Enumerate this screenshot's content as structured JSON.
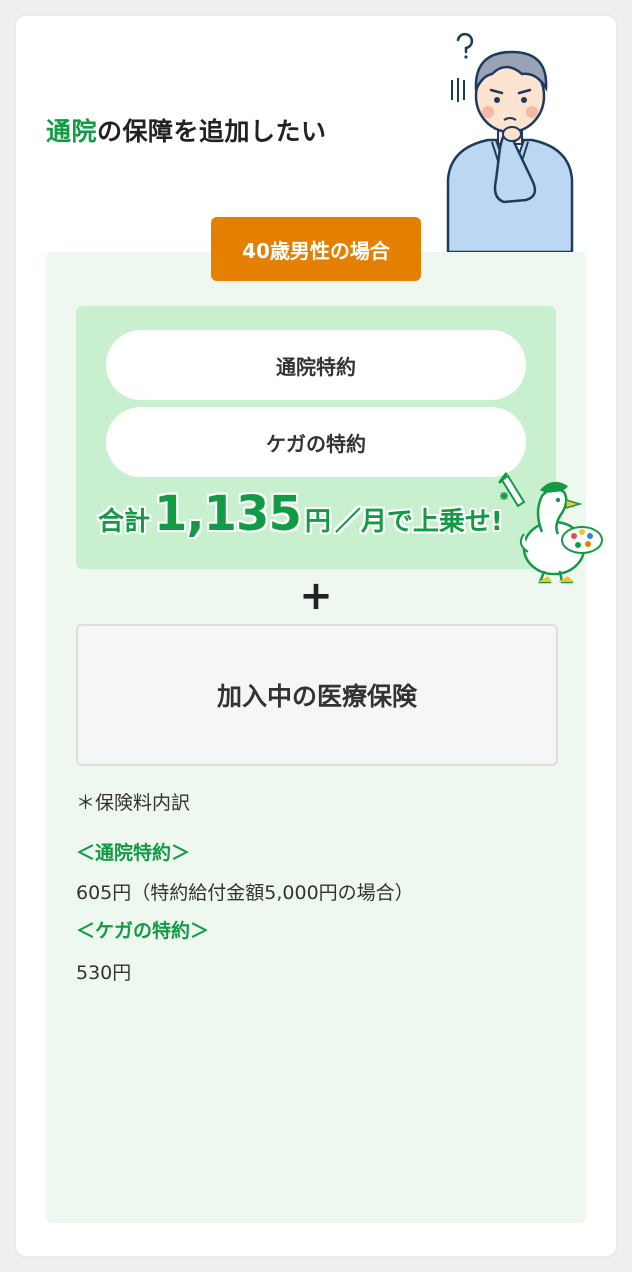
{
  "title": {
    "accent": "通院",
    "rest": "の保障を追加したい"
  },
  "age_badge": "40歳男性の場合",
  "riders": [
    "通院特約",
    "ケガの特約"
  ],
  "total": {
    "prefix": "合計",
    "amount": "1,135",
    "yen": "円",
    "suffix": "／月で上乗せ!"
  },
  "plus_symbol": "+",
  "current_insurance": "加入中の医療保険",
  "breakdown": {
    "note": "＊保険料内訳",
    "items": [
      {
        "heading": "＜通院特約＞",
        "value": "605円（特約給付金額5,000円の場合）"
      },
      {
        "heading": "＜ケガの特約＞",
        "value": "530円"
      }
    ]
  },
  "colors": {
    "accent_green": "#139a45",
    "badge_orange": "#e57f00",
    "panel_bg": "#eef8ef",
    "green_box_bg": "#c9f0ce"
  }
}
